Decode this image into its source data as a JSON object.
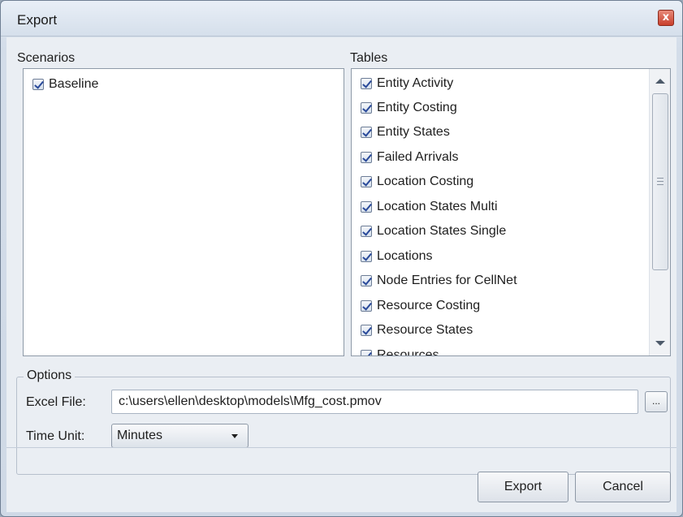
{
  "window": {
    "title": "Export",
    "close_symbol": "x"
  },
  "scenarios": {
    "label": "Scenarios",
    "items": [
      {
        "label": "Baseline",
        "checked": true
      }
    ]
  },
  "tables": {
    "label": "Tables",
    "items": [
      {
        "label": "Entity Activity",
        "checked": true
      },
      {
        "label": "Entity Costing",
        "checked": true
      },
      {
        "label": "Entity States",
        "checked": true
      },
      {
        "label": "Failed Arrivals",
        "checked": true
      },
      {
        "label": "Location Costing",
        "checked": true
      },
      {
        "label": "Location States Multi",
        "checked": true
      },
      {
        "label": "Location States Single",
        "checked": true
      },
      {
        "label": "Locations",
        "checked": true
      },
      {
        "label": "Node Entries for CellNet",
        "checked": true
      },
      {
        "label": "Resource Costing",
        "checked": true
      },
      {
        "label": "Resource States",
        "checked": true
      },
      {
        "label": "Resources",
        "checked": true
      }
    ]
  },
  "options": {
    "label": "Options",
    "excel_file_label": "Excel File:",
    "excel_file_value": "c:\\users\\ellen\\desktop\\models\\Mfg_cost.pmov",
    "browse_label": "...",
    "time_unit_label": "Time Unit:",
    "time_unit_value": "Minutes"
  },
  "buttons": {
    "export": "Export",
    "cancel": "Cancel"
  }
}
